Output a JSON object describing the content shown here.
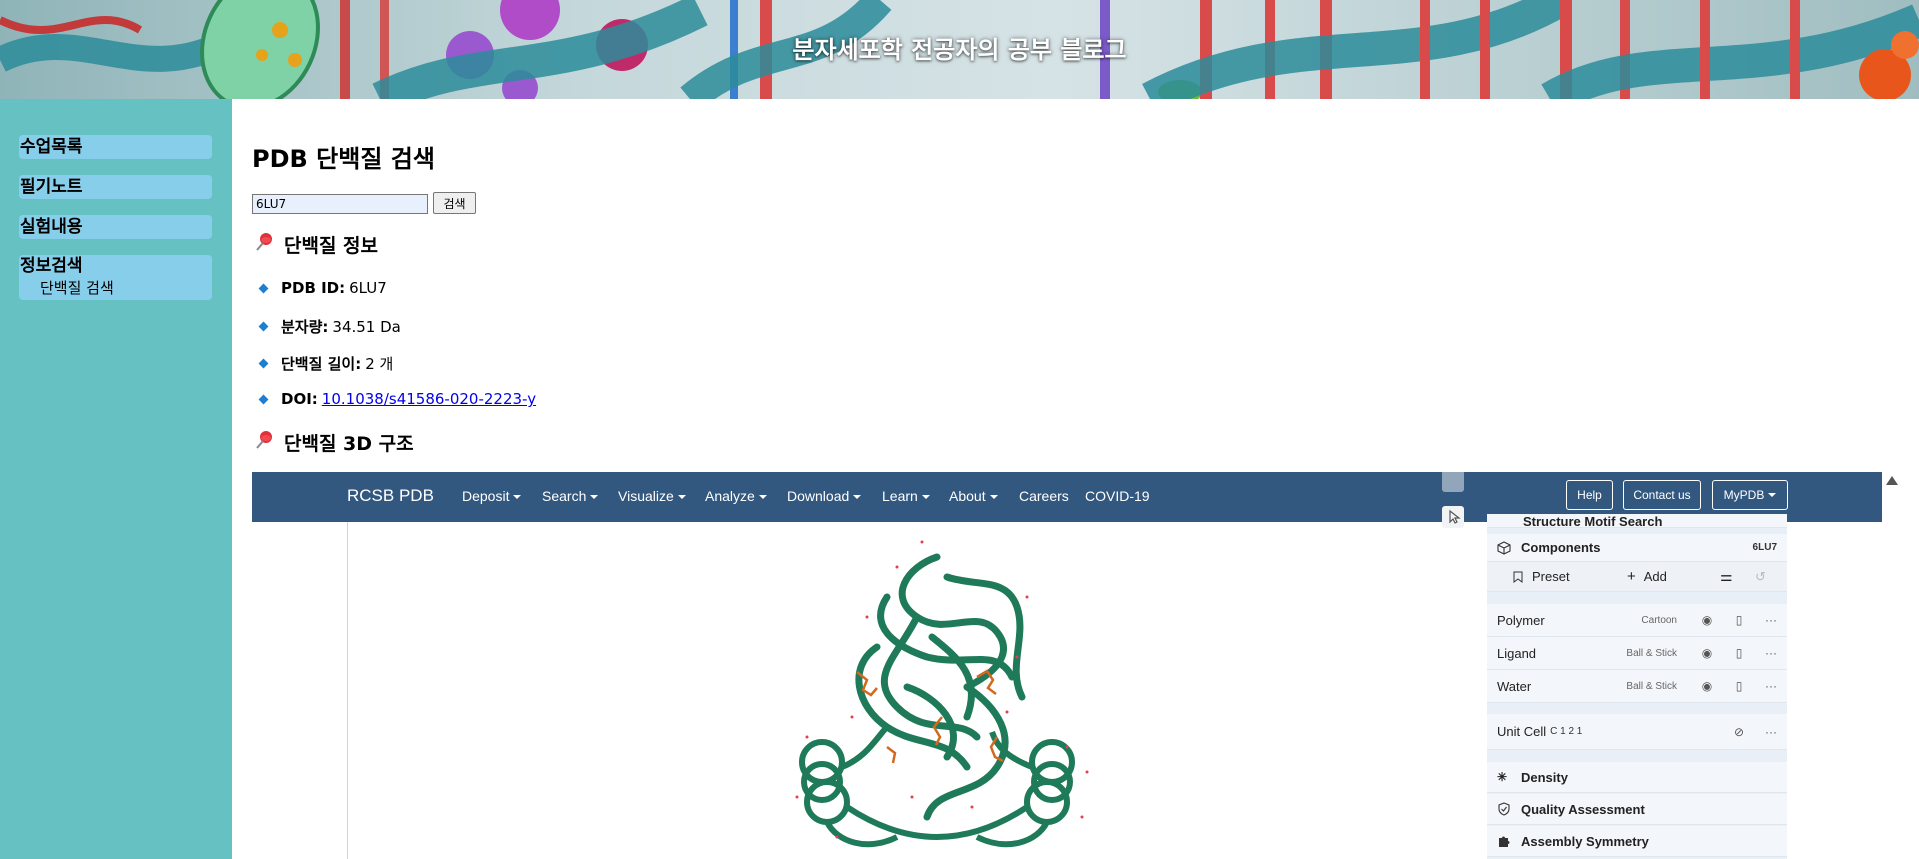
{
  "site": {
    "title": "분자세포학 전공자의 공부 블로그"
  },
  "sidebar": {
    "items": [
      {
        "label": "수업목록"
      },
      {
        "label": "필기노트"
      },
      {
        "label": "실험내용"
      },
      {
        "label": "정보검색",
        "children": [
          {
            "label": "단백질 검색"
          }
        ]
      }
    ]
  },
  "main": {
    "title": "PDB 단백질 검색",
    "search": {
      "value": "6LU7",
      "button_label": "검색"
    },
    "info_section": {
      "pin_icon": "pushpin-icon",
      "heading": "단백질 정보",
      "rows": [
        {
          "label": "PDB ID:",
          "value": "6LU7"
        },
        {
          "label": "분자량:",
          "value": "34.51 Da"
        },
        {
          "label": "단백질 길이:",
          "value": "2 개"
        },
        {
          "label": "DOI:",
          "value": "10.1038/s41586-020-2223-y"
        }
      ]
    },
    "structure_section": {
      "heading": "단백질 3D 구조"
    }
  },
  "rcsb": {
    "logo": "RCSB PDB",
    "nav": [
      "Deposit",
      "Search",
      "Visualize",
      "Analyze",
      "Download",
      "Learn",
      "About",
      "Careers",
      "COVID-19"
    ],
    "nav_with_caret": [
      true,
      true,
      true,
      true,
      true,
      true,
      true,
      false,
      false
    ],
    "buttons": {
      "help": "Help",
      "contact": "Contact us",
      "mypdb": "MyPDB"
    },
    "panel": {
      "cut_row": "Structure Motif Search",
      "components": {
        "label": "Components",
        "id": "6LU7"
      },
      "preset": "Preset",
      "add": "Add",
      "rows": [
        {
          "name": "Polymer",
          "repr": "Cartoon"
        },
        {
          "name": "Ligand",
          "repr": "Ball & Stick"
        },
        {
          "name": "Water",
          "repr": "Ball & Stick"
        }
      ],
      "unit_cell": {
        "name": "Unit Cell",
        "space_group": "C 1 2 1"
      },
      "sections": [
        "Density",
        "Quality Assessment",
        "Assembly Symmetry"
      ]
    }
  },
  "colors": {
    "sidebar_bg": "#66c2c2",
    "sidebar_item_bg": "#87ceeb",
    "rcsb_nav": "#325880",
    "protein": "#1f7a5a",
    "ligand": "#d2691e"
  }
}
